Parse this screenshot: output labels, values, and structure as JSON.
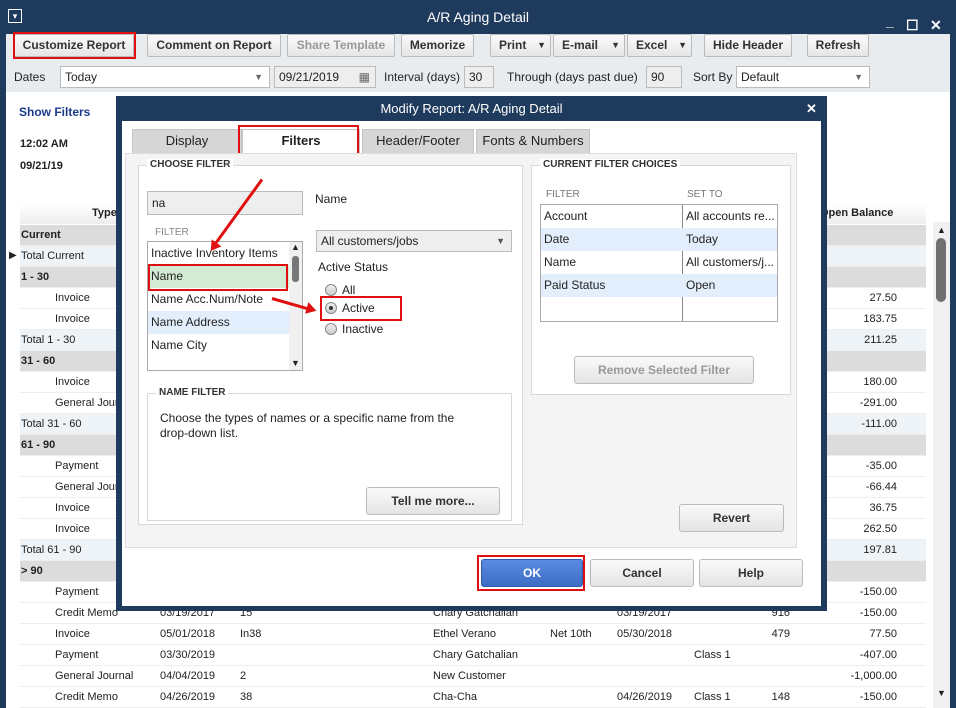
{
  "window": {
    "title": "A/R Aging Detail",
    "menu_icon": "▾",
    "minimize": "_",
    "maximize": "☐",
    "close": "✕"
  },
  "toolbar": {
    "customize": "Customize Report",
    "comment": "Comment on Report",
    "share": "Share Template",
    "memorize": "Memorize",
    "print": "Print",
    "email": "E-mail",
    "excel": "Excel",
    "hide_header": "Hide Header",
    "refresh": "Refresh"
  },
  "filters_bar": {
    "dates_label": "Dates",
    "dates_value": "Today",
    "date": "09/21/2019",
    "interval_label": "Interval (days)",
    "interval": "30",
    "through_label": "Through (days past due)",
    "through": "90",
    "sort_label": "Sort By",
    "sort_value": "Default"
  },
  "report": {
    "show_filters": "Show Filters",
    "time": "12:02 AM",
    "date": "09/21/19",
    "col_type": "Type",
    "col_balance": "Open Balance",
    "rows": [
      {
        "kind": "sec",
        "label": "Current"
      },
      {
        "kind": "tot",
        "label": "Total Current",
        "balance": ""
      },
      {
        "kind": "sec",
        "label": "1 - 30"
      },
      {
        "kind": "det",
        "type": "Invoice",
        "balance": "27.50"
      },
      {
        "kind": "det",
        "type": "Invoice",
        "balance": "183.75"
      },
      {
        "kind": "tot",
        "label": "Total 1 - 30",
        "balance": "211.25"
      },
      {
        "kind": "sec",
        "label": "31 - 60"
      },
      {
        "kind": "det",
        "type": "Invoice",
        "balance": "180.00"
      },
      {
        "kind": "det",
        "type": "General Journal",
        "balance": "-291.00"
      },
      {
        "kind": "tot",
        "label": "Total 31 - 60",
        "balance": "-111.00"
      },
      {
        "kind": "sec",
        "label": "61 - 90"
      },
      {
        "kind": "det",
        "type": "Payment",
        "balance": "-35.00"
      },
      {
        "kind": "det",
        "type": "General Journal",
        "balance": "-66.44"
      },
      {
        "kind": "det",
        "type": "Invoice",
        "balance": "36.75"
      },
      {
        "kind": "det",
        "type": "Invoice",
        "balance": "262.50"
      },
      {
        "kind": "tot",
        "label": "Total 61 - 90",
        "balance": "197.81"
      },
      {
        "kind": "sec",
        "label": "> 90"
      },
      {
        "kind": "det",
        "type": "Payment",
        "balance": "-150.00"
      },
      {
        "kind": "det",
        "type": "Credit Memo",
        "date": "03/19/2017",
        "num": "15",
        "name": "Chary Gatchalian",
        "due": "03/19/2017",
        "aging": "916",
        "balance": "-150.00"
      },
      {
        "kind": "det",
        "type": "Invoice",
        "date": "05/01/2018",
        "num": "In38",
        "name": "Ethel Verano",
        "terms": "Net 10th",
        "due": "05/30/2018",
        "aging": "479",
        "balance": "77.50"
      },
      {
        "kind": "det",
        "type": "Payment",
        "date": "03/30/2019",
        "name": "Chary Gatchalian",
        "class": "Class 1",
        "balance": "-407.00"
      },
      {
        "kind": "det",
        "type": "General Journal",
        "date": "04/04/2019",
        "num": "2",
        "name": "New Customer",
        "balance": "-1,000.00"
      },
      {
        "kind": "det",
        "type": "Credit Memo",
        "date": "04/26/2019",
        "num": "38",
        "name": "Cha-Cha",
        "due": "04/26/2019",
        "class": "Class 1",
        "aging": "148",
        "balance": "-150.00"
      }
    ]
  },
  "dialog": {
    "title": "Modify Report: A/R Aging Detail",
    "close": "✕",
    "tabs": [
      "Display",
      "Filters",
      "Header/Footer",
      "Fonts & Numbers"
    ],
    "choose_filter": "CHOOSE FILTER",
    "search_value": "na",
    "filter_label": "FILTER",
    "filter_items": [
      "Inactive Inventory Items",
      "Name",
      "Name Acc.Num/Note",
      "Name Address",
      "Name City"
    ],
    "selected_filter_title": "Name",
    "name_dropdown": "All customers/jobs",
    "active_status": "Active Status",
    "radios": [
      "All",
      "Active",
      "Inactive"
    ],
    "name_filter_title": "NAME FILTER",
    "name_filter_text": "Choose the types of names or a specific name from the drop-down list.",
    "tell_more": "Tell me more...",
    "current_choices": "CURRENT FILTER CHOICES",
    "cur_col_filter": "FILTER",
    "cur_col_set": "SET TO",
    "current": [
      {
        "filter": "Account",
        "set": "All accounts re..."
      },
      {
        "filter": "Date",
        "set": "Today"
      },
      {
        "filter": "Name",
        "set": "All customers/j..."
      },
      {
        "filter": "Paid Status",
        "set": "Open"
      }
    ],
    "remove": "Remove Selected Filter",
    "revert": "Revert",
    "ok": "OK",
    "cancel": "Cancel",
    "help": "Help"
  },
  "colors": {
    "navy": "#1e3a5c",
    "highlight": "#e01010",
    "ok_blue": "#4a7bd0",
    "selected_green": "#d3ead3"
  }
}
